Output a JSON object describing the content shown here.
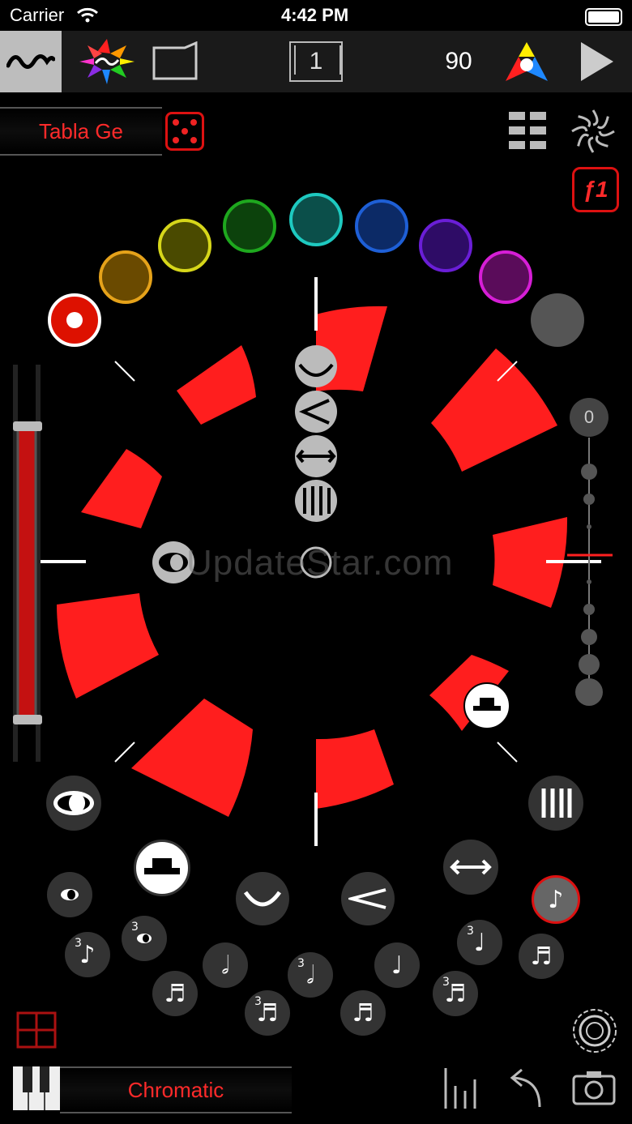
{
  "status": {
    "carrier": "Carrier",
    "time": "4:42 PM"
  },
  "toolbar": {
    "pattern_number": "1",
    "tempo": "90"
  },
  "instrument": {
    "name": "Tabla Ge"
  },
  "function_key": {
    "label": "ƒ1"
  },
  "scale": {
    "name": "Chromatic"
  },
  "slider_right": {
    "value": "0"
  },
  "watermark": {
    "text": "UpdateStar.com"
  },
  "notes": {
    "n1": "3",
    "n2": "3",
    "n3": "3",
    "n4": "3",
    "n5": "3",
    "n6": "3"
  },
  "colors": {
    "accent_red": "#ff1e1e",
    "palette": [
      "#ff2020",
      "#e5a21a",
      "#d6d61a",
      "#1ea81e",
      "#1ec9c0",
      "#1e5fd6",
      "#6a1ed6",
      "#d61ed6",
      "#666666"
    ]
  },
  "icons": [
    "wave-icon",
    "color-star-icon",
    "folder-icon",
    "triangle-color-icon",
    "play-icon",
    "dice-icon",
    "grid-icon",
    "spiral-icon",
    "piano-icon",
    "bars-icon",
    "undo-icon",
    "camera-icon",
    "target-icon",
    "quad-grid-icon"
  ]
}
